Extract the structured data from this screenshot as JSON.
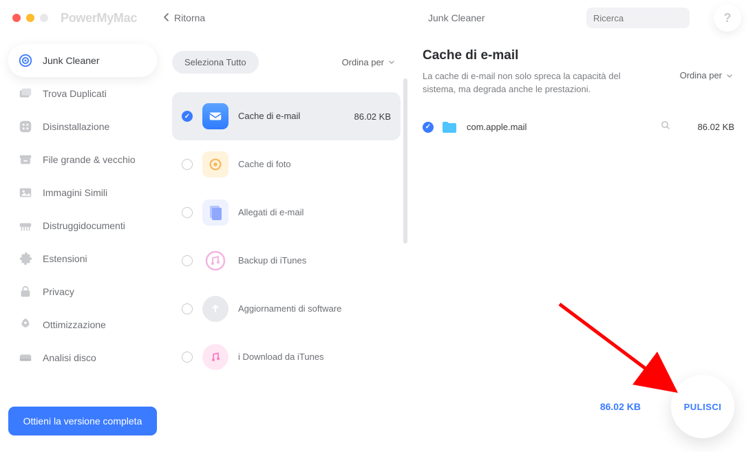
{
  "app_title": "PowerMyMac",
  "back_label": "Ritorna",
  "breadcrumb": "Junk Cleaner",
  "search_placeholder": "Ricerca",
  "help_label": "?",
  "sidebar": {
    "items": [
      {
        "label": "Junk Cleaner",
        "active": true
      },
      {
        "label": "Trova Duplicati",
        "active": false
      },
      {
        "label": "Disinstallazione",
        "active": false
      },
      {
        "label": "File grande & vecchio",
        "active": false
      },
      {
        "label": "Immagini Simili",
        "active": false
      },
      {
        "label": "Distruggidocumenti",
        "active": false
      },
      {
        "label": "Estensioni",
        "active": false
      },
      {
        "label": "Privacy",
        "active": false
      },
      {
        "label": "Ottimizzazione",
        "active": false
      },
      {
        "label": "Analisi disco",
        "active": false
      }
    ]
  },
  "cta_label": "Ottieni la versione completa",
  "select_all_label": "Seleziona Tutto",
  "sort_by_label": "Ordina per",
  "categories": [
    {
      "label": "Cache di e-mail",
      "size": "86.02 KB",
      "checked": true,
      "selected": true
    },
    {
      "label": "Cache di foto",
      "size": "",
      "checked": false,
      "selected": false
    },
    {
      "label": "Allegati di e-mail",
      "size": "",
      "checked": false,
      "selected": false
    },
    {
      "label": "Backup di iTunes",
      "size": "",
      "checked": false,
      "selected": false
    },
    {
      "label": "Aggiornamenti di software",
      "size": "",
      "checked": false,
      "selected": false
    },
    {
      "label": "i Download da iTunes",
      "size": "",
      "checked": false,
      "selected": false
    }
  ],
  "detail": {
    "title": "Cache di e-mail",
    "description": "La cache di e-mail non solo spreca la capacità del sistema, ma degrada anche le prestazioni.",
    "files": [
      {
        "name": "com.apple.mail",
        "size": "86.02 KB",
        "checked": true
      }
    ],
    "total": "86.02 KB",
    "clean_label": "PULISCI"
  }
}
